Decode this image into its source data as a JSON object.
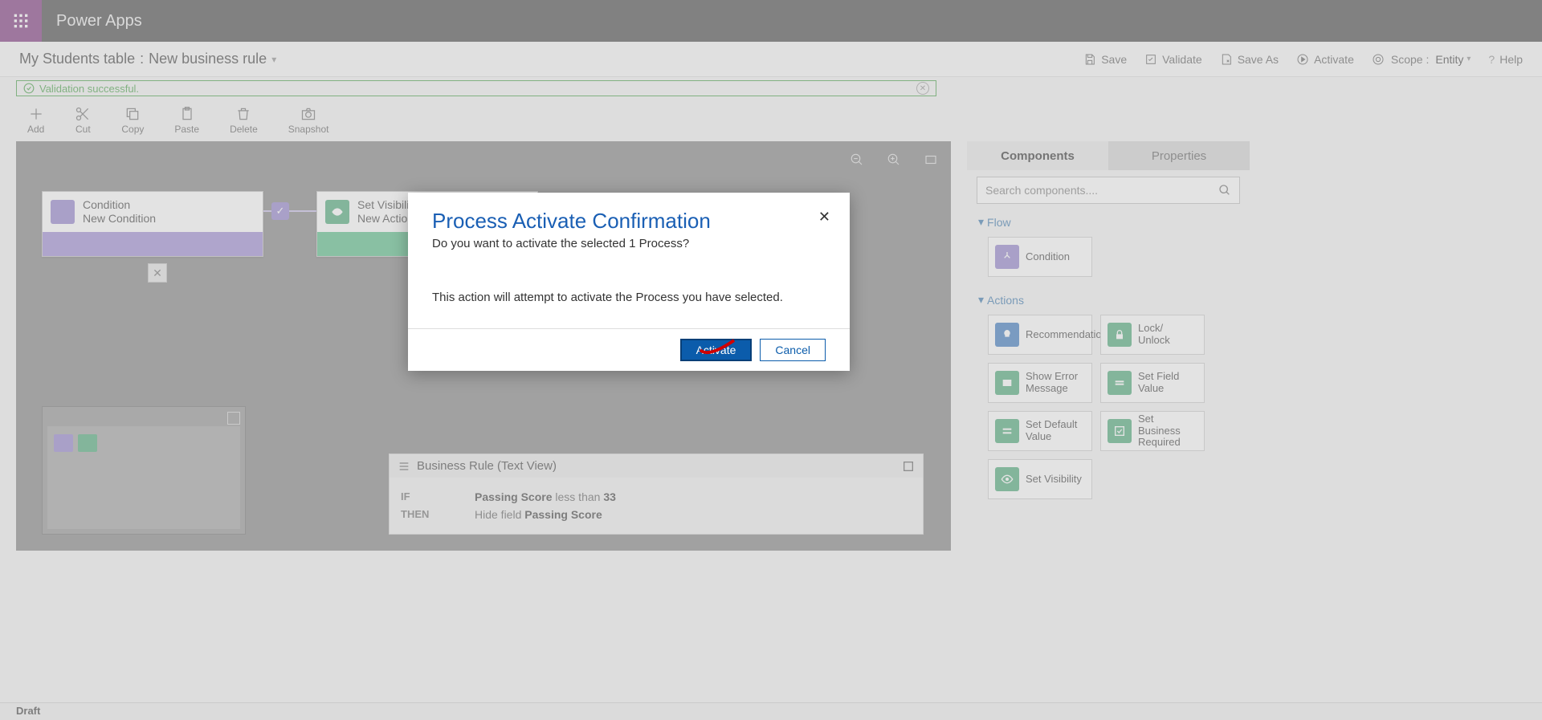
{
  "header": {
    "app_name": "Power Apps"
  },
  "breadcrumb": {
    "table": "My Students table",
    "rule": "New business rule"
  },
  "actions": {
    "save": "Save",
    "validate": "Validate",
    "saveas": "Save As",
    "activate": "Activate",
    "scope_label": "Scope :",
    "scope_value": "Entity",
    "help": "Help"
  },
  "validation_msg": "Validation successful.",
  "toolbar": {
    "add": "Add",
    "cut": "Cut",
    "copy": "Copy",
    "paste": "Paste",
    "delete": "Delete",
    "snapshot": "Snapshot"
  },
  "canvas": {
    "condition": {
      "title": "Condition",
      "sub": "New Condition"
    },
    "action": {
      "title": "Set Visibili",
      "sub": "New Actio"
    }
  },
  "textview": {
    "title": "Business Rule (Text View)",
    "if_kw": "IF",
    "then_kw": "THEN",
    "if_field": "Passing Score",
    "if_op": "less than",
    "if_val": "33",
    "then_prefix": "Hide field",
    "then_field": "Passing Score"
  },
  "sidepanel": {
    "tab_components": "Components",
    "tab_properties": "Properties",
    "search_placeholder": "Search components....",
    "section_flow": "Flow",
    "section_actions": "Actions",
    "comp_condition": "Condition",
    "comp_recommendation": "Recommendation",
    "comp_lock": "Lock/ Unlock",
    "comp_error": "Show Error Message",
    "comp_setfield": "Set Field Value",
    "comp_default": "Set Default Value",
    "comp_required": "Set Business Required",
    "comp_visibility": "Set Visibility"
  },
  "status": "Draft",
  "modal": {
    "title": "Process Activate Confirmation",
    "subtitle": "Do you want to activate the selected 1 Process?",
    "body": "This action will attempt to activate the Process you have selected.",
    "activate": "Activate",
    "cancel": "Cancel"
  }
}
